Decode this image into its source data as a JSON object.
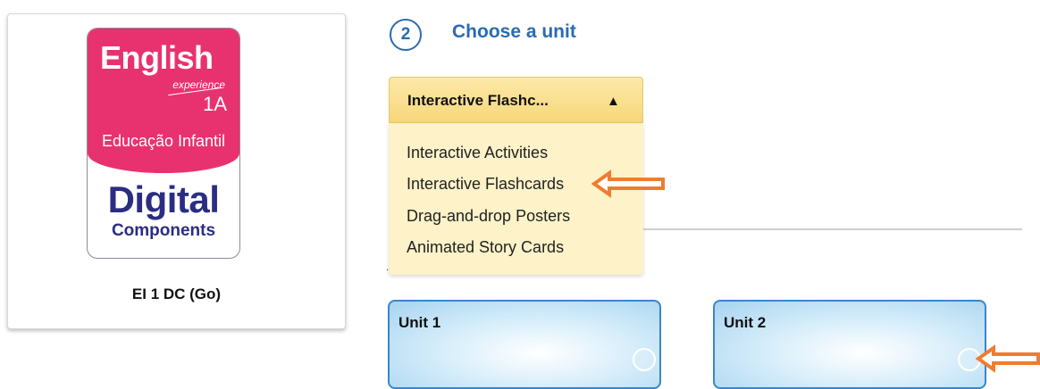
{
  "product": {
    "cover": {
      "brand": "English",
      "experience": "experience",
      "level": "1A",
      "edition": "Educação Infantil",
      "digital": "Digital",
      "components": "Components"
    },
    "label": "EI 1 DC (Go)"
  },
  "step": {
    "number": "2",
    "title": "Choose a unit"
  },
  "dropdown": {
    "selected": "Interactive Flashc...",
    "caret": "▲",
    "options": [
      "Interactive Activities",
      "Interactive Flashcards",
      "Drag-and-drop Posters",
      "Animated Story Cards"
    ]
  },
  "units": [
    {
      "title": "Unit 1"
    },
    {
      "title": "Unit 2"
    }
  ],
  "colors": {
    "accent": "#2a6bb0",
    "brand_pink": "#e8326f",
    "arrow": "#ee7d31"
  }
}
